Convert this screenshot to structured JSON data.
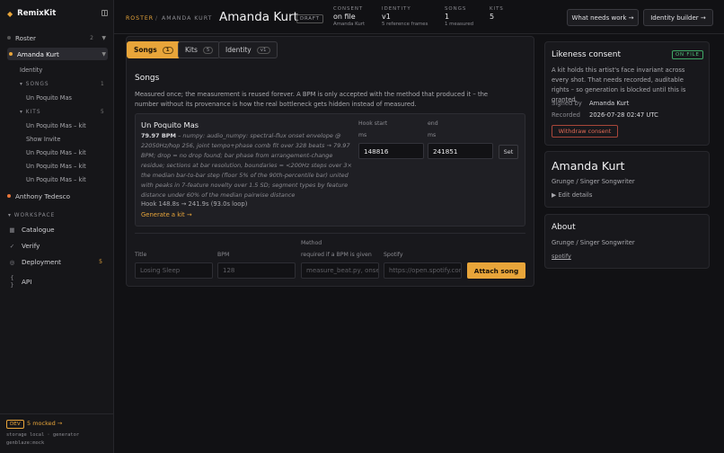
{
  "app": {
    "name": "RemixKit"
  },
  "sidebar": {
    "roster": {
      "label": "Roster",
      "count": "2"
    },
    "artist_active": {
      "label": "Amanda Kurt"
    },
    "identity_label": "Identity",
    "songs_section": {
      "label": "SONGS",
      "count": "1"
    },
    "songs_items": [
      "Un Poquito Mas"
    ],
    "kits_section": {
      "label": "KITS",
      "count": "5"
    },
    "kits_items": [
      "Un Poquito Mas – kit",
      "Show Invite",
      "Un Poquito Mas – kit",
      "Un Poquito Mas – kit",
      "Un Poquito Mas – kit"
    ],
    "artist_other": {
      "label": "Anthony Tedesco"
    },
    "workspace_label": "WORKSPACE",
    "workspace_items": [
      {
        "label": "Catalogue",
        "icon": "grid-icon"
      },
      {
        "label": "Verify",
        "icon": "check-icon"
      },
      {
        "label": "Deployment",
        "icon": "circle-icon",
        "count": "5"
      },
      {
        "label": "API",
        "icon": "braces-icon"
      }
    ],
    "footer": {
      "dev_badge": "DEV",
      "mocked": "5 mocked →",
      "storage": "storage local · generator",
      "genblaze": "genblaze:mock"
    }
  },
  "header": {
    "breadcrumb_root": "ROSTER",
    "breadcrumb_sep": "/",
    "breadcrumb_artist": "AMANDA KURT",
    "title": "Amanda Kurt",
    "status_badge": "DRAFT",
    "stats": [
      {
        "label": "CONSENT",
        "value": "on file",
        "sub": "Amanda Kurt"
      },
      {
        "label": "IDENTITY",
        "value": "v1",
        "sub": "5 reference frames"
      },
      {
        "label": "SONGS",
        "value": "1",
        "sub": "1 measured"
      },
      {
        "label": "KITS",
        "value": "5",
        "sub": ""
      }
    ],
    "btn_needs_work": "What needs work →",
    "btn_identity_builder": "Identity builder →"
  },
  "tabs": [
    {
      "label": "Songs",
      "count": "1"
    },
    {
      "label": "Kits",
      "count": "5"
    },
    {
      "label": "Identity",
      "count": "v1"
    }
  ],
  "songs": {
    "heading": "Songs",
    "description": "Measured once; the measurement is reused forever. A BPM is only accepted with the method that produced it – the number without its provenance is how the real bottleneck gets hidden instead of measured.",
    "song": {
      "title": "Un Poquito Mas",
      "bpm": "79.97 BPM",
      "analysis": " – numpy: audio_numpy: spectral-flux onset envelope @ 22050Hz/hop 256, joint tempo+phase comb fit over 328 beats → 79.97 BPM; drop = no drop found; bar phase from arrangement-change residue; sections at bar resolution, boundaries = <200Hz steps over 3× the median bar-to-bar step (floor 5% of the 90th-percentile bar) united with peaks in 7-feature novelty over 1.5 SD; segment types by feature distance under 60% of the median pairwise distance",
      "hook": "Hook 148.8s → 241.9s (93.0s loop)",
      "generate_link": "Generate a kit →",
      "hook_start_label": "Hook start",
      "end_label": "end",
      "ms_label_1": "ms",
      "ms_label_2": "ms",
      "hook_start_value": "148816",
      "end_value": "241851",
      "set_button": "Set"
    },
    "attach_form": {
      "title_label": "Title",
      "title_placeholder": "Losing Sleep",
      "bpm_label": "BPM",
      "bpm_placeholder": "128",
      "method_label": "Method",
      "method_sublabel": "required if a BPM is given",
      "method_placeholder": "measure_beat.py, onset...",
      "spotify_label": "Spotify",
      "spotify_placeholder": "https://open.spotify.com/...",
      "attach_button": "Attach song"
    }
  },
  "likeness": {
    "title": "Likeness consent",
    "badge": "ON FILE",
    "text": "A kit holds this artist's face invariant across every shot. That needs recorded, auditable rights – so generation is blocked until this is granted.",
    "signed_by_label": "Signed by",
    "signed_by_value": "Amanda Kurt",
    "recorded_label": "Recorded",
    "recorded_value": "2026-07-28 02:47 UTC",
    "withdraw_button": "Withdraw consent"
  },
  "artist_card": {
    "name": "Amanda Kurt",
    "genre": "Grunge / Singer Songwriter",
    "edit_details": "Edit details"
  },
  "about": {
    "title": "About",
    "genre": "Grunge / Singer Songwriter",
    "spotify_link": "spotify"
  },
  "colors": {
    "accent": "#e8a53a",
    "consent_green": "#4fc07a",
    "danger": "#e06a55"
  }
}
